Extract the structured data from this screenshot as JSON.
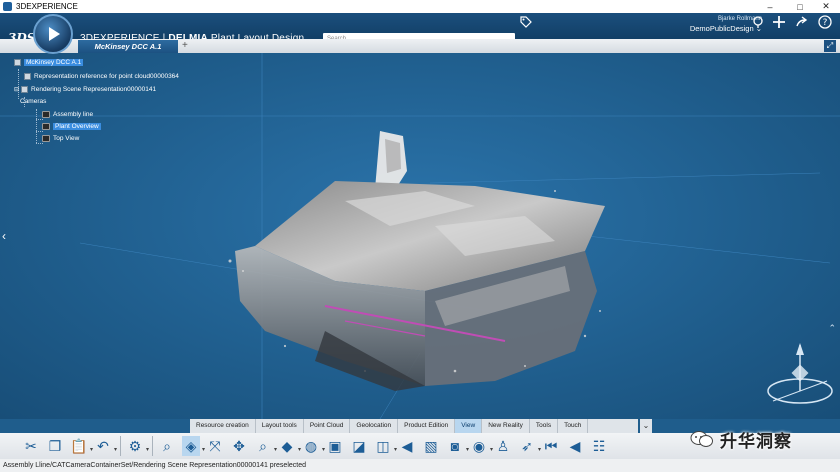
{
  "window": {
    "title": "3DEXPERIENCE",
    "controls": [
      "–",
      "□",
      "✕"
    ]
  },
  "header": {
    "logo": "3DS",
    "brand_prefix": "3DEXPERIENCE | ",
    "brand_app": "DELMIA",
    "brand_suffix": " Plant Layout Design",
    "search_placeholder": "Search",
    "user_name": "Bjarke Rollmann",
    "user_context": "DemoPublicDesign",
    "icons": [
      "search-icon",
      "tag-icon",
      "share-icon",
      "add-icon",
      "forward-icon",
      "help-icon"
    ]
  },
  "tabs": {
    "active_document": "McKinsey DCC A.1",
    "add_label": "+"
  },
  "tree": {
    "root": "McKinsey DCC A.1",
    "items": [
      "Representation reference for point cloud00000364",
      "Rendering Scene Representation00000141",
      "Cameras",
      "Assembly line",
      "Plant Overview",
      "Top View"
    ]
  },
  "section_tabs": [
    {
      "label": "Resource creation",
      "active": false
    },
    {
      "label": "Layout tools",
      "active": false
    },
    {
      "label": "Point Cloud",
      "active": false
    },
    {
      "label": "Geolocation",
      "active": false
    },
    {
      "label": "Product Edition",
      "active": false
    },
    {
      "label": "View",
      "active": true
    },
    {
      "label": "New Reality",
      "active": false
    },
    {
      "label": "Tools",
      "active": false
    },
    {
      "label": "Touch",
      "active": false
    }
  ],
  "toolbar_icons": [
    "cut-icon",
    "copy-icon",
    "paste-icon",
    "undo-icon",
    "settings-icon",
    "zoom-icon",
    "view-cube-icon",
    "fit-all-icon",
    "pan-icon",
    "zoom-area-icon",
    "render-style-icon",
    "shading-icon",
    "viewpoint-icon",
    "section-icon",
    "layout-icon",
    "prev-icon",
    "capture-icon",
    "camera-icon",
    "look-icon",
    "walk-icon",
    "fly-icon",
    "first-icon",
    "previous-icon",
    "tree-icon"
  ],
  "status": "Assembly Lline/CATCameraContainerSet/Rendering Scene Representation00000141 preselected",
  "watermark": "升华洞察",
  "colors": {
    "viewport_bg": "#1f5d8c",
    "header_bg": "#123f66",
    "highlight": "#3a8de0"
  }
}
